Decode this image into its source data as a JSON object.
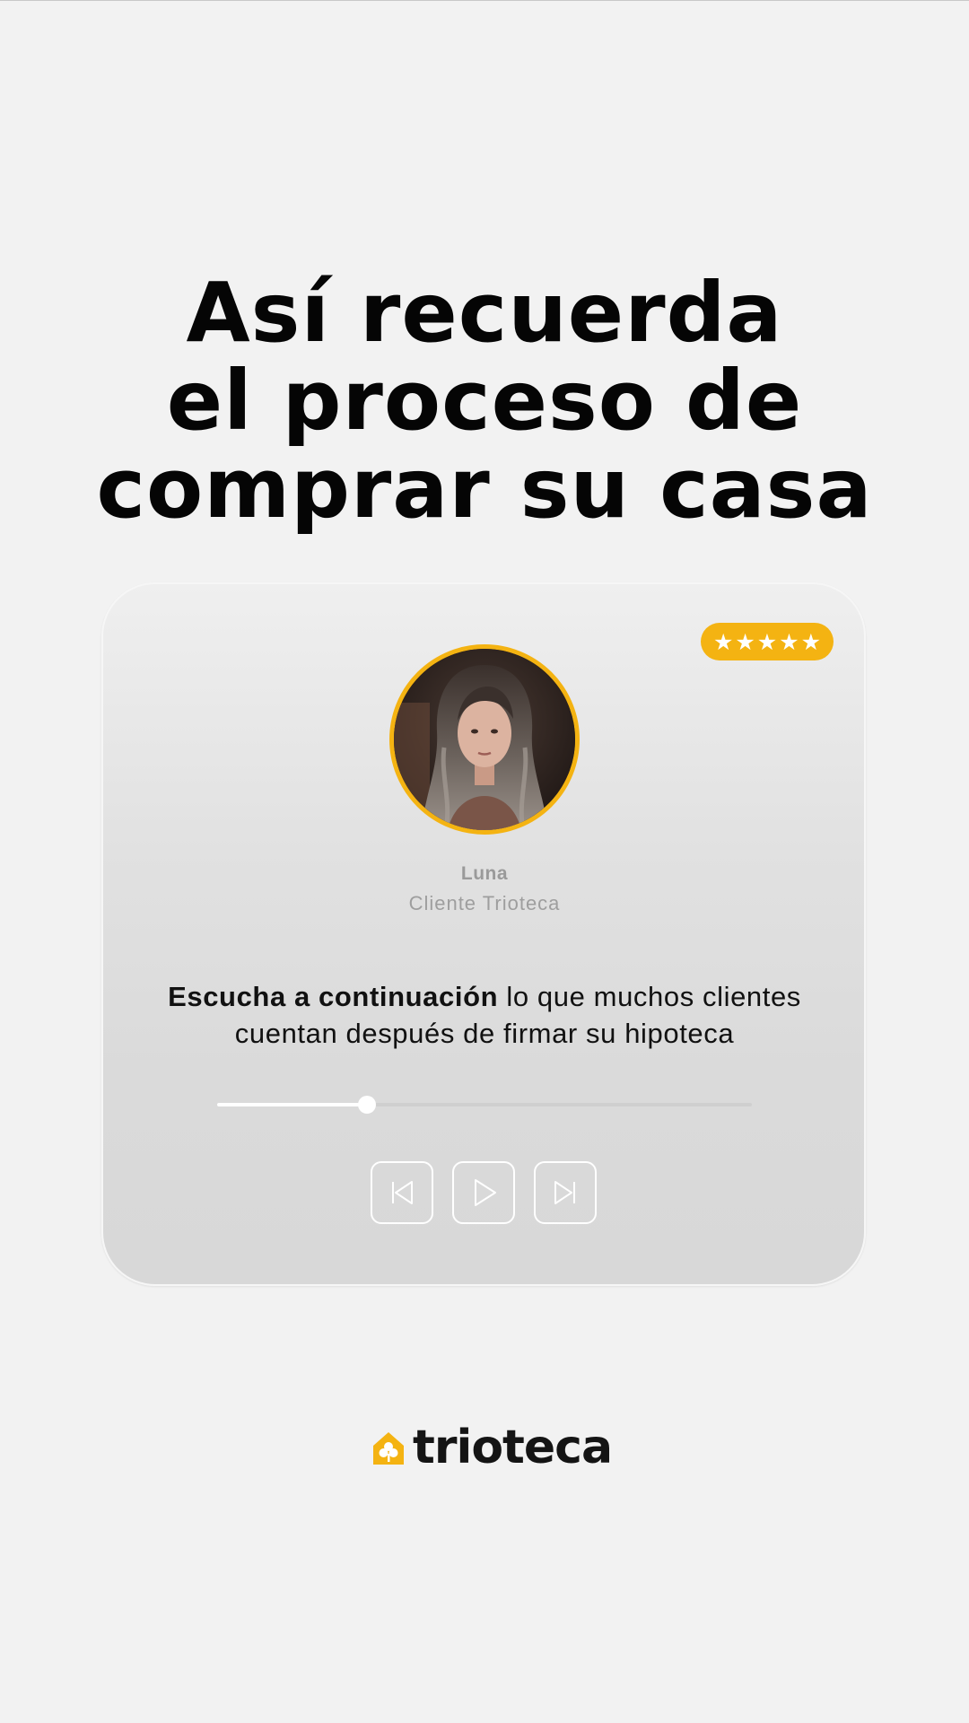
{
  "headline": {
    "line1": "Así recuerda",
    "line2": "el proceso de",
    "line3": "comprar su casa"
  },
  "card": {
    "rating": {
      "stars": [
        "★",
        "★",
        "★",
        "★",
        "★"
      ],
      "value": 5,
      "max": 5
    },
    "avatar_alt": "Luna",
    "name": "Luna",
    "role": "Cliente Trioteca",
    "message_bold": "Escucha a continuación",
    "message_rest": " lo que muchos clientes cuentan después de firmar su hipoteca",
    "player": {
      "progress": 0.28,
      "controls": [
        {
          "name": "previous-track",
          "icon": "skip-back-icon"
        },
        {
          "name": "play",
          "icon": "play-icon"
        },
        {
          "name": "next-track",
          "icon": "skip-forward-icon"
        }
      ]
    }
  },
  "brand": {
    "wordmark": "trioteca",
    "logo_icon": "house-clover-icon"
  },
  "colors": {
    "accent": "#f4b312",
    "background": "#f2f2f2",
    "text": "#050505"
  }
}
